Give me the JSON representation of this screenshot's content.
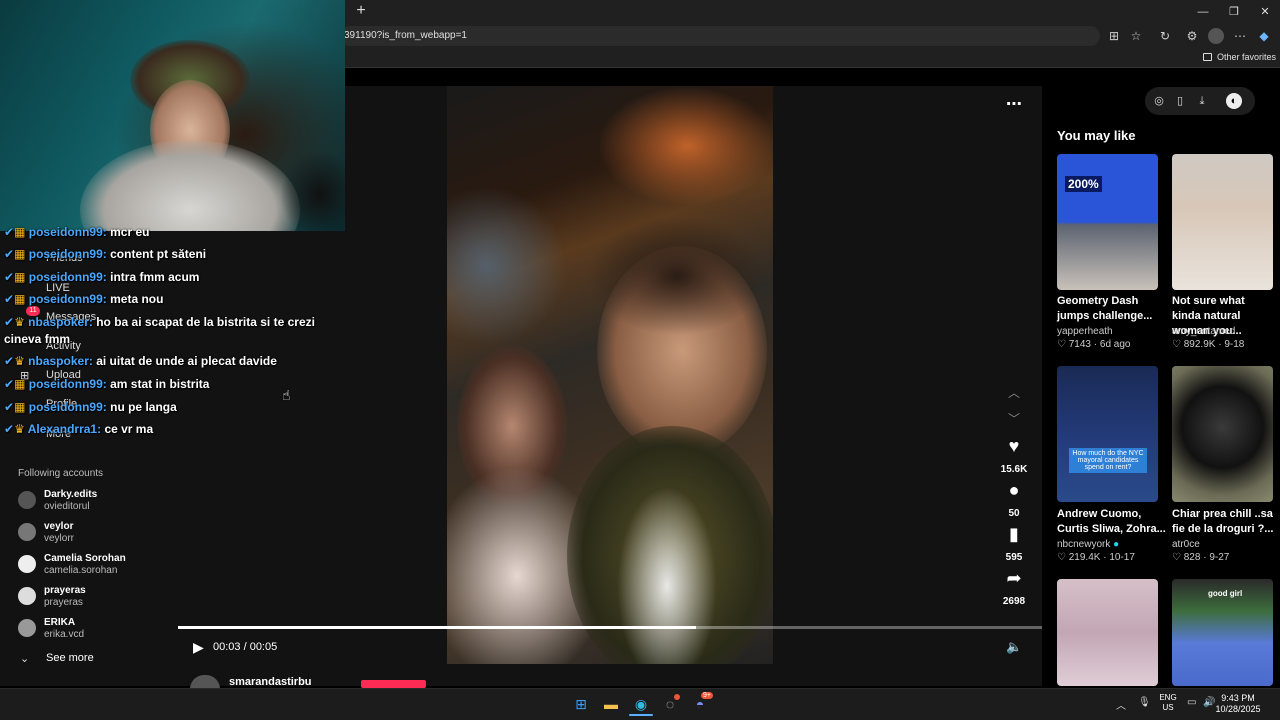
{
  "browser": {
    "new_tab": "+",
    "url": "391190?is_from_webapp=1",
    "other_favorites": "Other favorites",
    "window_buttons": [
      "—",
      "❐",
      "✕"
    ]
  },
  "sidebar": {
    "nav": [
      "Friends",
      "LIVE",
      "Messages",
      "Activity",
      "Upload",
      "Profile",
      "More"
    ],
    "messages_badge": "11",
    "following_title": "Following accounts",
    "accounts": [
      {
        "name": "Darky.edits",
        "handle": "ovieditorul"
      },
      {
        "name": "veylor",
        "handle": "veylorr"
      },
      {
        "name": "Camelia Sorohan",
        "handle": "camelia.sorohan"
      },
      {
        "name": "prayeras",
        "handle": "prayeras"
      },
      {
        "name": "ERIKA",
        "handle": "erika.vcd"
      }
    ],
    "see_more": "See more"
  },
  "chat": [
    {
      "user": "poseidonn99:",
      "msg": "mcr eu"
    },
    {
      "user": "poseidonn99:",
      "msg": "content pt săteni"
    },
    {
      "user": "poseidonn99:",
      "msg": "intra fmm acum"
    },
    {
      "user": "poseidonn99:",
      "msg": "meta nou"
    },
    {
      "user": "nbaspoker:",
      "msg": "ho ba ai scapat de la bistrita si te crezi"
    },
    {
      "user": "",
      "msg": "cineva fmm"
    },
    {
      "user": "nbaspoker:",
      "msg": "ai uitat de unde ai plecat davide"
    },
    {
      "user": "poseidonn99:",
      "msg": "am stat in bistrita"
    },
    {
      "user": "poseidonn99:",
      "msg": "nu pe langa"
    },
    {
      "user": "Alexandrra1:",
      "msg": "ce vr ma"
    }
  ],
  "player": {
    "time": "00:03 / 00:05",
    "progress": 0.6,
    "likes": "15.6K",
    "comments": "50",
    "saves": "595",
    "shares": "2698",
    "author": "smarandastirbu"
  },
  "recommendations": {
    "title": "You may like",
    "items": [
      {
        "title": "Geometry Dash jumps challenge...",
        "author": "yapperheath",
        "likes": "7143",
        "date": "6d ago",
        "thumb_text": "200%"
      },
      {
        "title": "Not sure what kinda natural woman you...",
        "author": "amy_untamed",
        "likes": "892.9K",
        "date": "9-18",
        "thumb_text": ""
      },
      {
        "title": "Andrew Cuomo, Curtis Sliwa, Zohra...",
        "author": "nbcnewyork",
        "likes": "219.4K",
        "date": "10-17",
        "thumb_text": "How much do the NYC mayoral candidates spend on rent?"
      },
      {
        "title": "Chiar prea chill ..sa fie de la droguri ?...",
        "author": "atr0ce",
        "likes": "828",
        "date": "9-27",
        "thumb_text": ""
      },
      {
        "title": "",
        "author": "",
        "likes": "",
        "date": "",
        "thumb_text": ""
      },
      {
        "title": "",
        "author": "",
        "likes": "",
        "date": "",
        "thumb_text": "good girl"
      }
    ]
  },
  "taskbar": {
    "lang": "ENG",
    "region": "US",
    "time": "9:43 PM",
    "date": "10/28/2025",
    "discord_badge": "9+"
  },
  "colors": {
    "accent_red": "#fe2c55",
    "chat_user": "#4aa8ff",
    "verified": "#20d5ec"
  }
}
